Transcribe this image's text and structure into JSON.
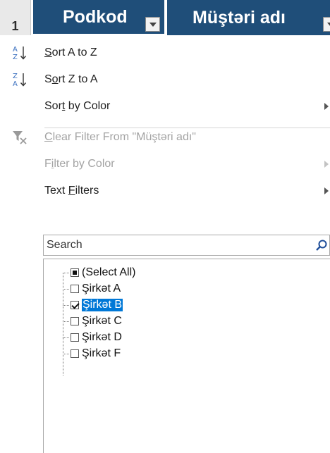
{
  "header": {
    "row_number": "1",
    "columns": [
      {
        "label": "Podkod"
      },
      {
        "label": "Müştəri adı"
      }
    ]
  },
  "menu": {
    "sort_a_to_z": {
      "label": "Sort A to Z",
      "icon": "sort-ascending-icon"
    },
    "sort_z_to_a": {
      "label": "Sort Z to A",
      "icon": "sort-descending-icon"
    },
    "sort_by_color": {
      "label": "Sort by Color"
    },
    "clear_filter": {
      "label": "Clear Filter From \"Müştəri adı\"",
      "icon": "clear-filter-icon"
    },
    "filter_by_color": {
      "label": "Filter by Color"
    },
    "text_filters": {
      "label": "Text Filters"
    }
  },
  "search": {
    "placeholder": "Search",
    "icon": "search-icon"
  },
  "list": {
    "items": [
      {
        "label": "(Select All)",
        "state": "partial"
      },
      {
        "label": "Şirkət A",
        "state": "unchecked"
      },
      {
        "label": "Şirkət B",
        "state": "checked",
        "selected": true
      },
      {
        "label": "Şirkət C",
        "state": "unchecked"
      },
      {
        "label": "Şirkət D",
        "state": "unchecked"
      },
      {
        "label": "Şirkət F",
        "state": "unchecked"
      }
    ]
  },
  "colors": {
    "header_bg": "#1f4e79",
    "selection": "#0078d7",
    "disabled_text": "#a3a3a3"
  }
}
